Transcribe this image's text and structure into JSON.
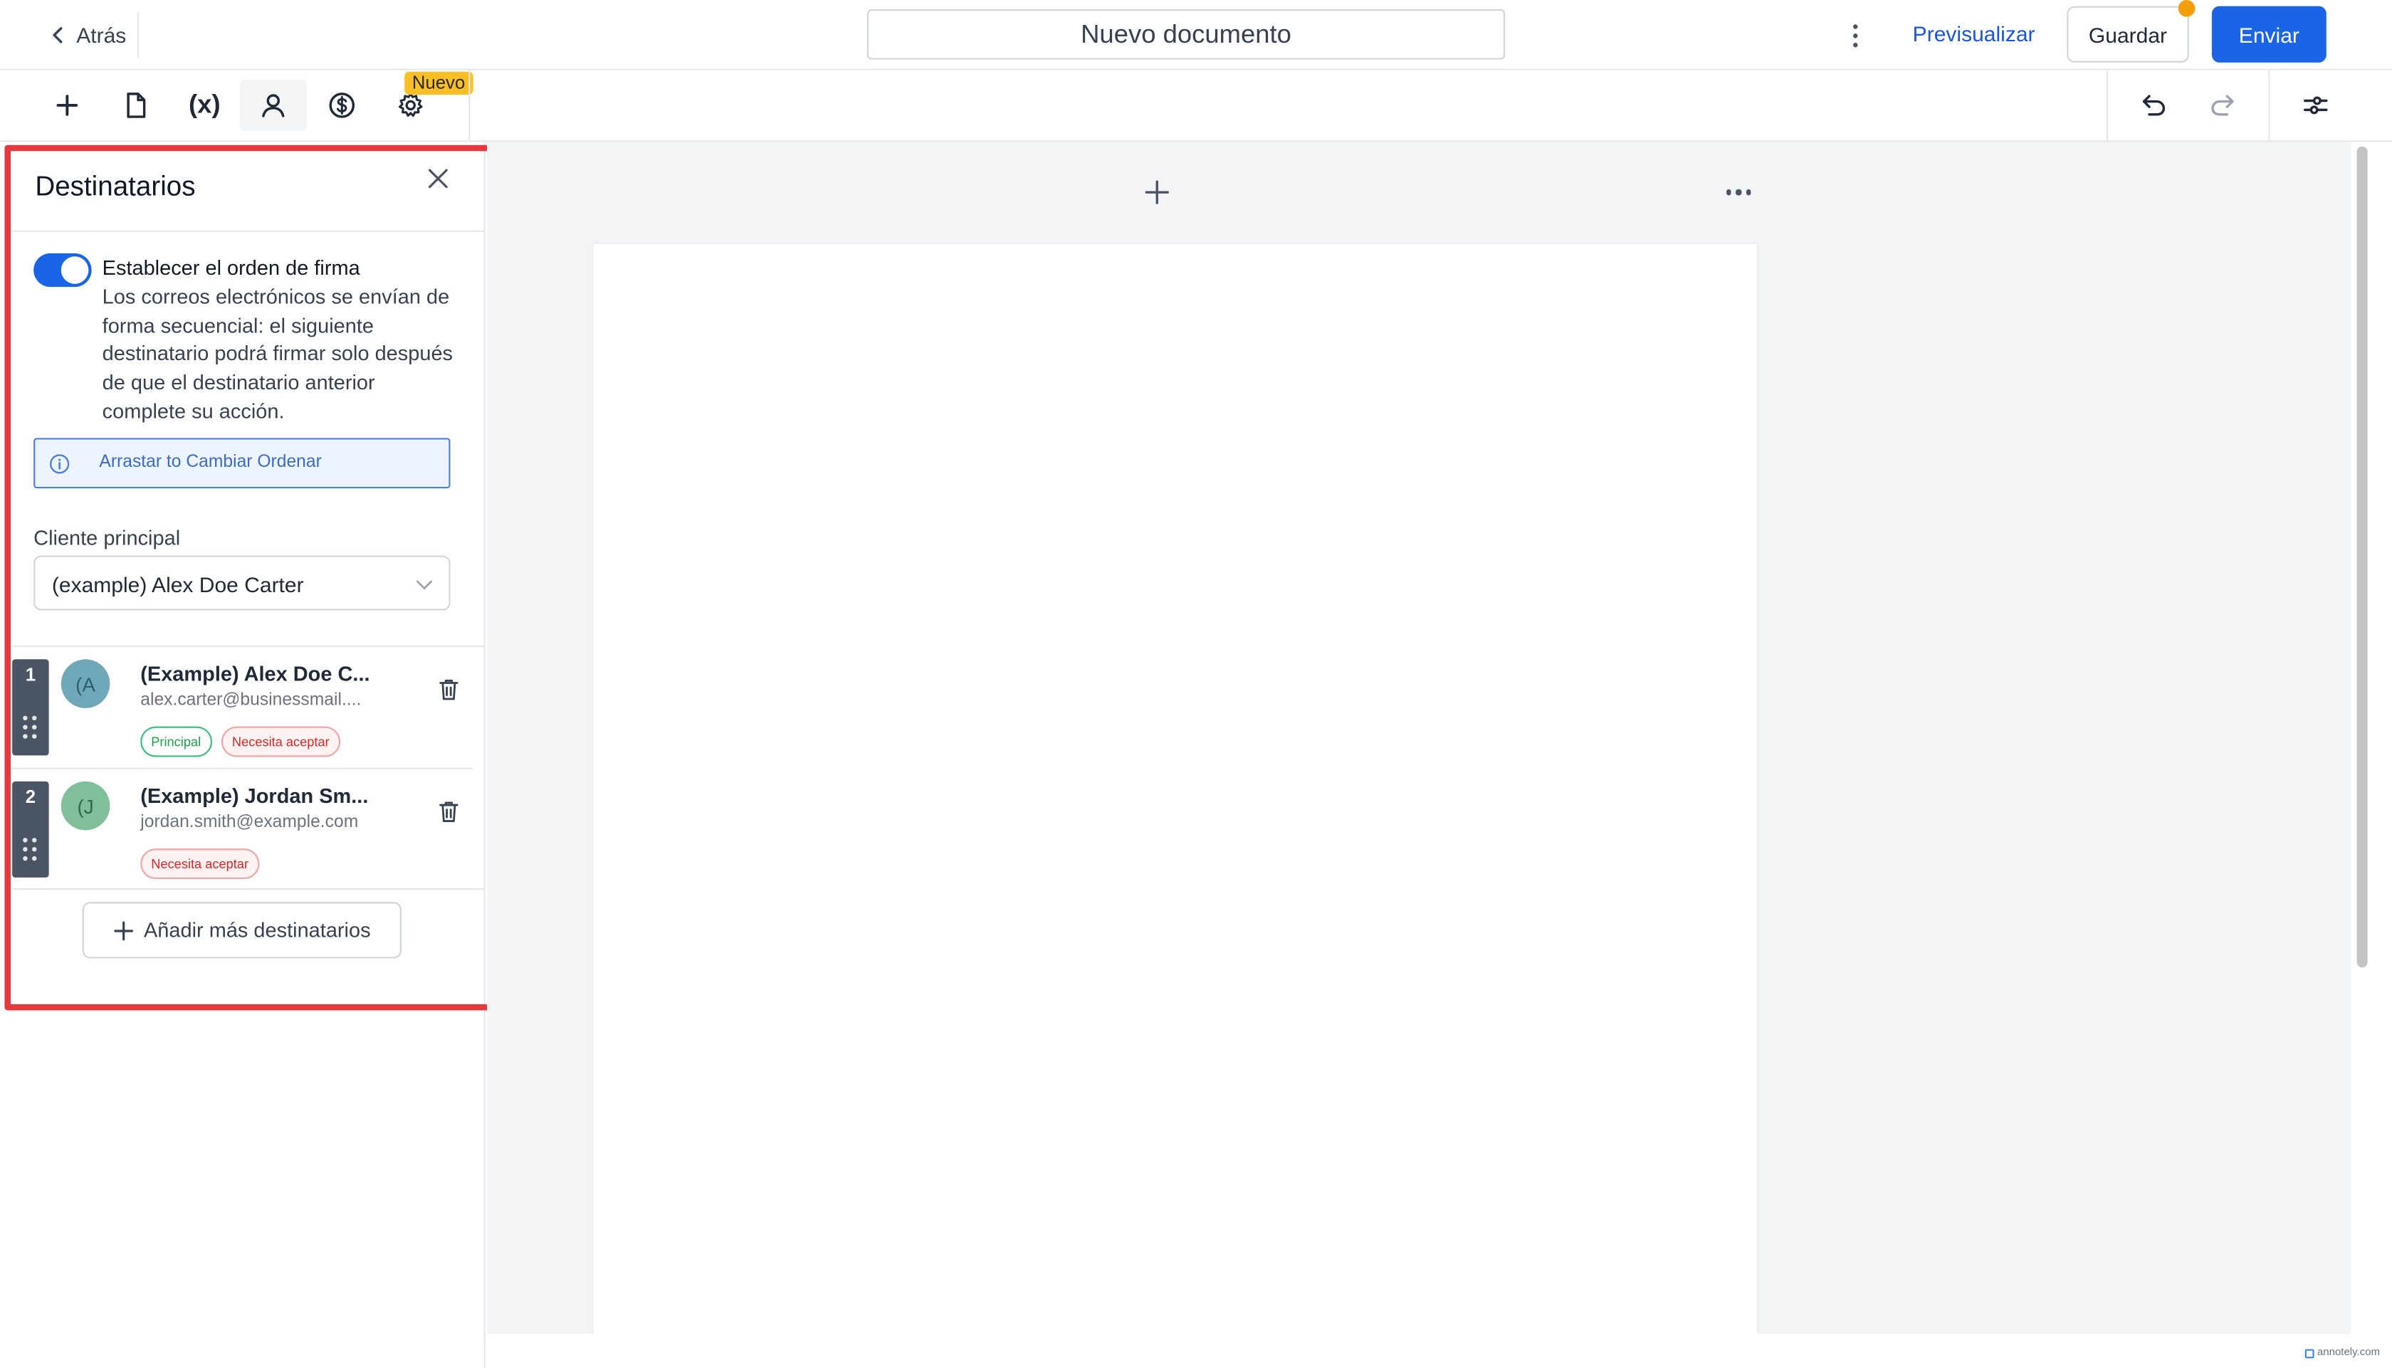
{
  "header": {
    "back_label": "Atrás",
    "document_title": "Nuevo documento",
    "preview_label": "Previsualizar",
    "save_label": "Guardar",
    "send_label": "Enviar"
  },
  "toolbar": {
    "tools": [
      {
        "name": "add",
        "icon": "plus-icon"
      },
      {
        "name": "document",
        "icon": "file-icon"
      },
      {
        "name": "variables",
        "icon": "variable-icon",
        "label": "(x)"
      },
      {
        "name": "recipients",
        "icon": "user-icon",
        "active": true
      },
      {
        "name": "pricing",
        "icon": "dollar-circle-icon"
      },
      {
        "name": "settings",
        "icon": "gear-icon"
      }
    ],
    "new_badge": "Nuevo"
  },
  "recipients_panel": {
    "title": "Destinatarios",
    "signing_order": {
      "enabled": true,
      "title": "Establecer el orden de firma",
      "description": "Los correos electrónicos se envían de forma secuencial: el siguiente destinatario podrá firmar solo después de que el destinatario anterior complete su acción."
    },
    "drag_info": "Arrastar to Cambiar Ordenar",
    "primary_client_label": "Cliente principal",
    "primary_client_value": "(example) Alex Doe Carter",
    "recipients": [
      {
        "order": "1",
        "initials": "(A",
        "name": "(Example) Alex Doe C...",
        "email": "alex.carter@businessmail....",
        "tags": [
          "Principal",
          "Necesita aceptar"
        ],
        "avatar_bg": "#6fa8b8",
        "avatar_fg": "#2f5f6e"
      },
      {
        "order": "2",
        "initials": "(J",
        "name": "(Example) Jordan Sm...",
        "email": "jordan.smith@example.com",
        "tags": [
          "Necesita aceptar"
        ],
        "avatar_bg": "#7fbf9a",
        "avatar_fg": "#2f6b4a"
      }
    ],
    "add_more_label": "Añadir más destinatarios"
  },
  "colors": {
    "primary": "#1a64e8",
    "highlight_border": "#e5393f",
    "badge": "#fbbf24"
  },
  "watermark": "annotely.com"
}
